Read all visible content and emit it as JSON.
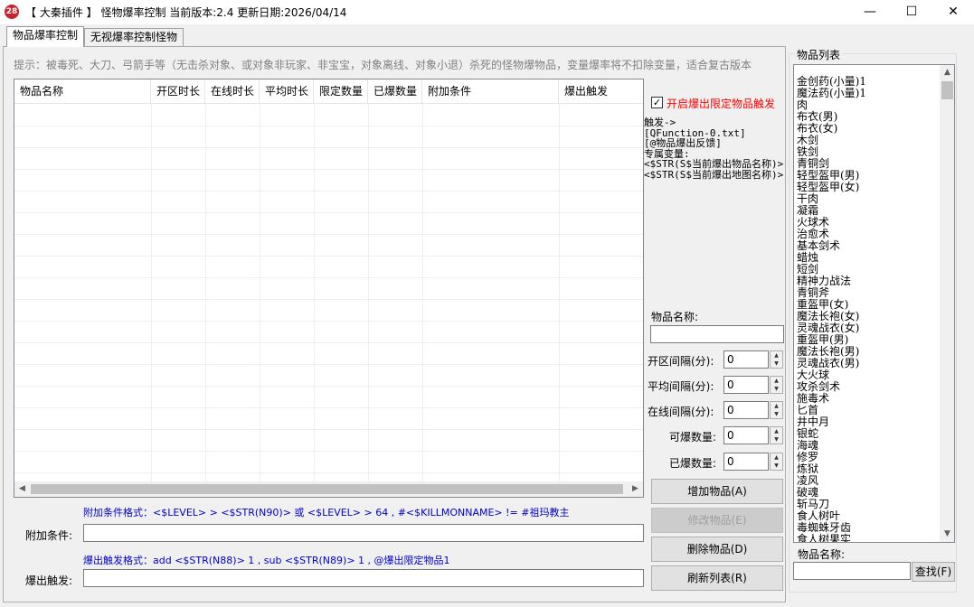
{
  "window": {
    "icon_text": "28",
    "title": "【 大秦插件 】 怪物爆率控制 当前版本:2.4 更新日期:2026/04/14",
    "minimize": "—",
    "maximize": "☐",
    "close": "✕"
  },
  "tabs": [
    {
      "label": "物品爆率控制",
      "active": true
    },
    {
      "label": "无视爆率控制怪物",
      "active": false
    }
  ],
  "hint": "提示：被毒死、大刀、弓箭手等（无击杀对象、或对象非玩家、非宝宝，对象离线、对象小退）杀死的怪物爆物品，变量爆率将不扣除变量，适合复古版本",
  "table": {
    "columns": [
      "物品名称",
      "开区时长",
      "在线时长",
      "平均时长",
      "限定数量",
      "已爆数量",
      "附加条件",
      "爆出触发"
    ],
    "rows": []
  },
  "options": {
    "limit_trigger_checked": "✓",
    "limit_trigger_label": "开启爆出限定物品触发",
    "trigger_info": "触发->\n[QFunction-0.txt]\n[@物品爆出反馈]\n专属变量:\n<$STR(S$当前爆出物品名称)>\n<$STR(S$当前爆出地图名称)>"
  },
  "form": {
    "item_name_label": "物品名称:",
    "item_name_value": "",
    "open_interval_label": "开区间隔(分):",
    "open_interval_value": "0",
    "avg_interval_label": "平均间隔(分):",
    "avg_interval_value": "0",
    "online_interval_label": "在线间隔(分):",
    "online_interval_value": "0",
    "drop_count_label": "可爆数量:",
    "drop_count_value": "0",
    "dropped_count_label": "已爆数量:",
    "dropped_count_value": "0"
  },
  "buttons": {
    "add": "增加物品(A)",
    "edit": "修改物品(E)",
    "delete": "删除物品(D)",
    "refresh": "刷新列表(R)",
    "find": "查找(F)"
  },
  "bottom": {
    "condition_format": "附加条件格式：<$LEVEL> > <$STR(N90)> 或 <$LEVEL> > 64 , #<$KILLMONNAME> != #祖玛教主",
    "condition_label": "附加条件:",
    "condition_value": "",
    "trigger_format": "爆出触发格式：add <$STR(N88)> 1 , sub <$STR(N89)> 1 , @爆出限定物品1",
    "trigger_label": "爆出触发:",
    "trigger_value": ""
  },
  "item_list": {
    "title": "物品列表",
    "items": [
      "金创药(小量)1",
      "魔法药(小量)1",
      "肉",
      "布衣(男)",
      "布衣(女)",
      "木剑",
      "铁剑",
      "青铜剑",
      "轻型盔甲(男)",
      "轻型盔甲(女)",
      "干肉",
      "凝霜",
      "火球术",
      "治愈术",
      "基本剑术",
      "蜡烛",
      "短剑",
      "精神力战法",
      "青铜斧",
      "重盔甲(女)",
      "魔法长袍(女)",
      "灵魂战衣(女)",
      "重盔甲(男)",
      "魔法长袍(男)",
      "灵魂战衣(男)",
      "大火球",
      "攻杀剑术",
      "施毒术",
      "匕首",
      "井中月",
      "银蛇",
      "海魂",
      "修罗",
      "炼狱",
      "凌风",
      "破魂",
      "斩马刀",
      "食人树叶",
      "毒蜘蛛牙齿",
      "食人树果实"
    ],
    "search_label": "物品名称:",
    "search_value": ""
  }
}
